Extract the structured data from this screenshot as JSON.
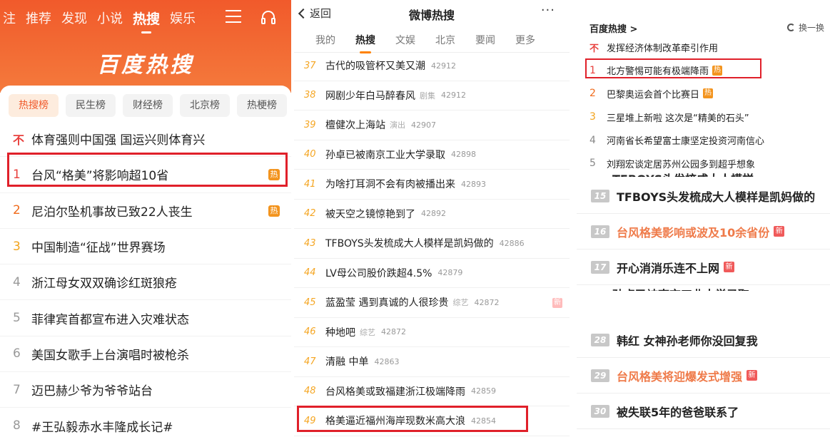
{
  "baidu_mobile": {
    "nav": [
      "注",
      "推荐",
      "发现",
      "小说",
      "热搜",
      "娱乐"
    ],
    "title": "百度热搜",
    "tabs": [
      "热搜榜",
      "民生榜",
      "财经榜",
      "北京榜",
      "热梗榜"
    ],
    "items": [
      {
        "rank": "不",
        "text": "体育强则中国强 国运兴则体育兴",
        "badge": ""
      },
      {
        "rank": "1",
        "text": "台风“格美”将影响超10省",
        "badge": "热"
      },
      {
        "rank": "2",
        "text": "尼泊尔坠机事故已致22人丧生",
        "badge": "热"
      },
      {
        "rank": "3",
        "text": "中国制造“征战”世界赛场",
        "badge": ""
      },
      {
        "rank": "4",
        "text": "浙江母女双双确诊红斑狼疮",
        "badge": ""
      },
      {
        "rank": "5",
        "text": "菲律宾首都宣布进入灾难状态",
        "badge": ""
      },
      {
        "rank": "6",
        "text": "美国女歌手上台演唱时被枪杀",
        "badge": ""
      },
      {
        "rank": "7",
        "text": "迈巴赫少爷为爷爷站台",
        "badge": ""
      },
      {
        "rank": "8",
        "text": "#王弘毅赤水丰隆成长记#",
        "badge": ""
      }
    ]
  },
  "weibo_mobile": {
    "back": "返回",
    "title": "微博热搜",
    "more": "···",
    "tabs": [
      "我的",
      "热搜",
      "文娱",
      "北京",
      "要闻",
      "更多"
    ],
    "items": [
      {
        "rank": "37",
        "text": "古代的吸管杯又美又潮",
        "tag": "",
        "count": "42912",
        "new": ""
      },
      {
        "rank": "38",
        "text": "网剧少年白马醉春风",
        "tag": "剧集",
        "count": "42912",
        "new": ""
      },
      {
        "rank": "39",
        "text": "檀健次上海站",
        "tag": "演出",
        "count": "42907",
        "new": ""
      },
      {
        "rank": "40",
        "text": "孙卓已被南京工业大学录取",
        "tag": "",
        "count": "42898",
        "new": ""
      },
      {
        "rank": "41",
        "text": "为啥打耳洞不会有肉被播出来",
        "tag": "",
        "count": "42893",
        "new": ""
      },
      {
        "rank": "42",
        "text": "被天空之镜惊艳到了",
        "tag": "",
        "count": "42892",
        "new": ""
      },
      {
        "rank": "43",
        "text": "TFBOYS头发梳成大人模样是凯妈做的",
        "tag": "",
        "count": "42886",
        "new": ""
      },
      {
        "rank": "44",
        "text": "LV母公司股价跌超4.5%",
        "tag": "",
        "count": "42879",
        "new": ""
      },
      {
        "rank": "45",
        "text": "蓝盈莹 遇到真诚的人很珍贵",
        "tag": "综艺",
        "count": "42872",
        "new": "新"
      },
      {
        "rank": "46",
        "text": "种地吧",
        "tag": "综艺",
        "count": "42872",
        "new": ""
      },
      {
        "rank": "47",
        "text": "清融 中单",
        "tag": "",
        "count": "42863",
        "new": ""
      },
      {
        "rank": "48",
        "text": "台风格美或致福建浙江极端降雨",
        "tag": "",
        "count": "42859",
        "new": ""
      },
      {
        "rank": "49",
        "text": "格美逼近福州海岸现数米高大浪",
        "tag": "",
        "count": "42854",
        "new": ""
      }
    ]
  },
  "baidu_pc": {
    "title": "百度热搜 >",
    "refresh": "换一换",
    "items": [
      {
        "rank": "不",
        "text": "发挥经济体制改革牵引作用",
        "badge": ""
      },
      {
        "rank": "1",
        "text": "北方警惕可能有极端降雨",
        "badge": "热"
      },
      {
        "rank": "2",
        "text": "巴黎奥运会首个比赛日",
        "badge": "热"
      },
      {
        "rank": "3",
        "text": "三星堆上新啦 这次是“精美的石头”",
        "badge": ""
      },
      {
        "rank": "4",
        "text": "河南省长希望富士康坚定投资河南信心",
        "badge": ""
      },
      {
        "rank": "5",
        "text": "刘翔宏谈定居苏州公园多到超乎想象",
        "badge": ""
      }
    ]
  },
  "weibo_cards_a": {
    "items": [
      {
        "num": "15",
        "text": "TFBOYS头发梳成大人模样是凯妈做的",
        "hot": false,
        "new": ""
      },
      {
        "num": "16",
        "text": "台风格美影响或波及10余省份",
        "hot": true,
        "new": "新"
      },
      {
        "num": "17",
        "text": "开心消消乐连不上网",
        "hot": false,
        "new": "新"
      }
    ]
  },
  "weibo_cards_b": {
    "items": [
      {
        "num": "28",
        "text": "韩红 女神孙老师你没回复我",
        "hot": false,
        "new": ""
      },
      {
        "num": "29",
        "text": "台风格美将迎爆发式增强",
        "hot": true,
        "new": "新"
      },
      {
        "num": "30",
        "text": "被失联5年的爸爸联系了",
        "hot": false,
        "new": ""
      }
    ]
  },
  "colors": {
    "baidu_orange": "#f15a2b",
    "highlight_red": "#e0202a",
    "weibo_rank_orange": "#f5a623",
    "hot_badge": "#f3941e"
  }
}
